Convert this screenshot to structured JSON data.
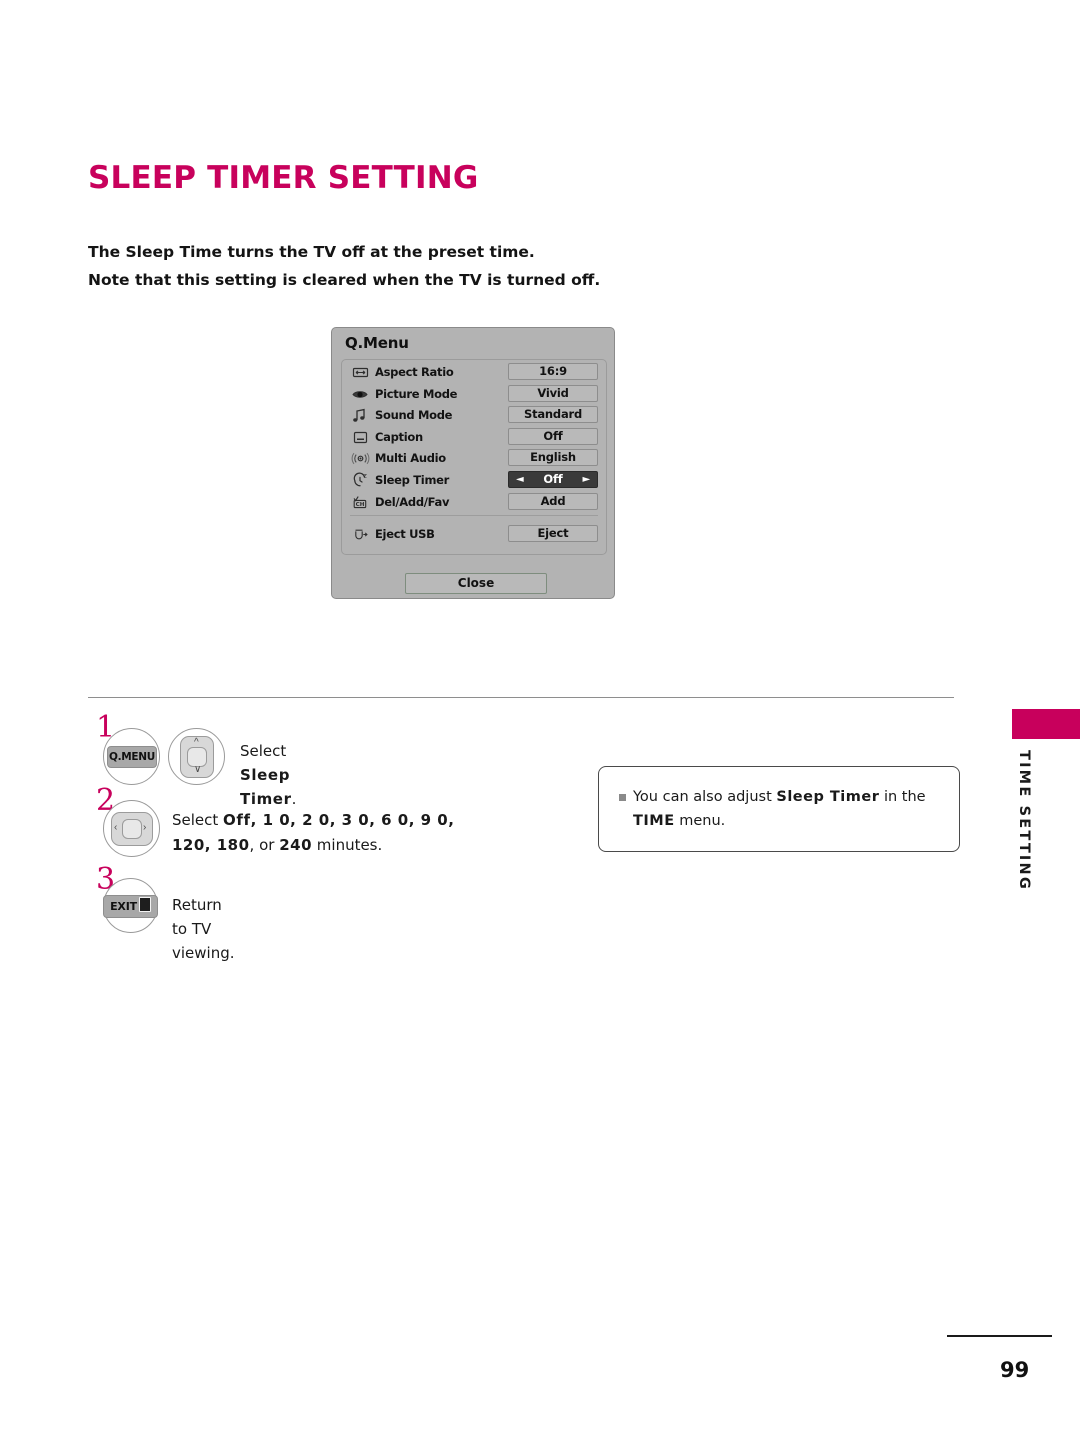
{
  "page": {
    "title": "SLEEP TIMER SETTING",
    "title_color": "#c8015c",
    "number": "99",
    "intro_line1": "The Sleep Time turns the TV off at the preset time.",
    "intro_line2": "Note that this setting is cleared when the TV is turned off."
  },
  "qmenu": {
    "title": "Q.Menu",
    "rows": [
      {
        "icon": "aspect-ratio-icon",
        "label": "Aspect Ratio",
        "value": "16:9",
        "selected": false
      },
      {
        "icon": "eye-icon",
        "label": "Picture Mode",
        "value": "Vivid",
        "selected": false
      },
      {
        "icon": "music-note-icon",
        "label": "Sound Mode",
        "value": "Standard",
        "selected": false
      },
      {
        "icon": "caption-icon",
        "label": "Caption",
        "value": "Off",
        "selected": false
      },
      {
        "icon": "multi-audio-icon",
        "label": "Multi Audio",
        "value": "English",
        "selected": false
      },
      {
        "icon": "sleep-timer-icon",
        "label": "Sleep Timer",
        "value": "Off",
        "selected": true
      },
      {
        "icon": "channel-fav-icon",
        "label": "Del/Add/Fav",
        "value": "Add",
        "selected": false
      }
    ],
    "eject": {
      "icon": "eject-usb-icon",
      "label": "Eject USB",
      "value": "Eject"
    },
    "close_label": "Close",
    "arrow_left": "◄",
    "arrow_right": "►"
  },
  "steps": [
    {
      "number": "1",
      "key_label": "Q.MENU",
      "text_prefix": "Select ",
      "text_bold": "Sleep Timer",
      "text_suffix": "."
    },
    {
      "number": "2",
      "text_line1_prefix": "Select ",
      "text_line1_bold1": "Off",
      "text_line1_rest": ", 1 0, 2 0, 3 0, 6 0, 9 0,",
      "text_line2_bold": "120, 180",
      "text_line2_mid": ", or ",
      "text_line2_bold2": "240",
      "text_line2_suffix": " minutes."
    },
    {
      "number": "3",
      "key_label": "EXIT",
      "text": "Return to TV viewing."
    }
  ],
  "note": {
    "prefix": "You can also adjust ",
    "bold1": "Sleep Timer",
    "mid": " in the ",
    "bold2": "TIME",
    "suffix": " menu."
  },
  "sidebar": {
    "label": "TIME SETTING",
    "accent_color": "#c8005c"
  }
}
